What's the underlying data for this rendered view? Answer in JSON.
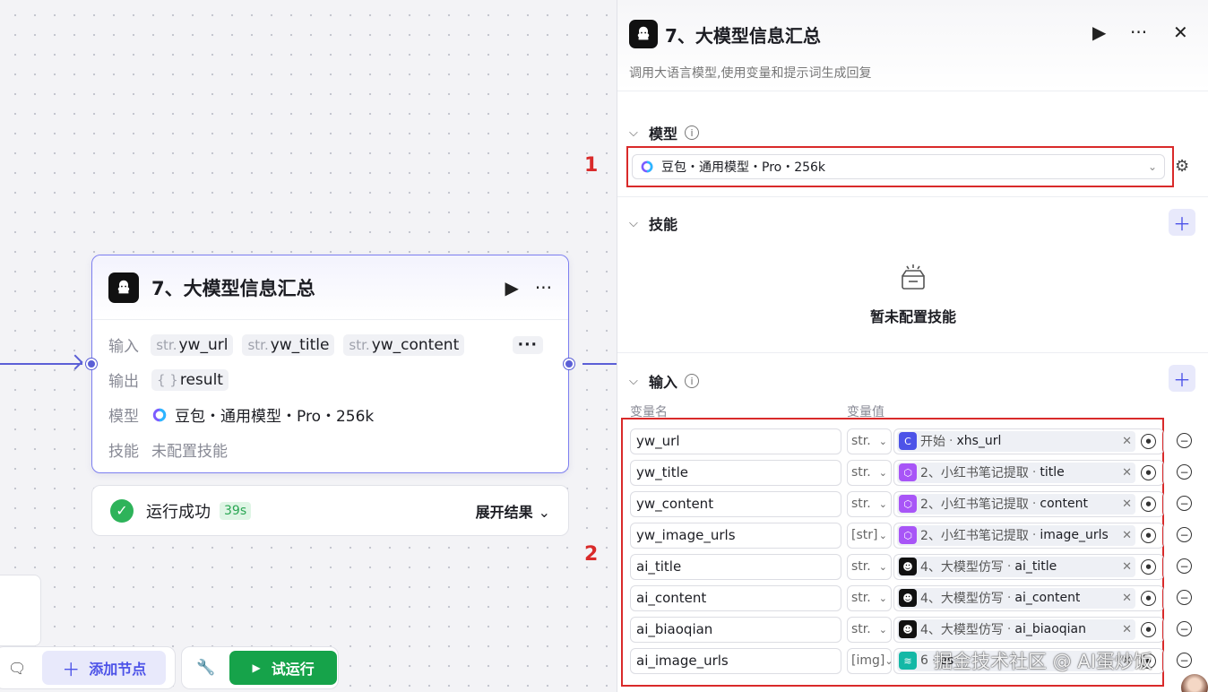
{
  "canvas": {
    "node": {
      "title": "7、大模型信息汇总",
      "input_label": "输入",
      "inputs": [
        {
          "type": "str.",
          "name": "yw_url"
        },
        {
          "type": "str.",
          "name": "yw_title"
        },
        {
          "type": "str.",
          "name": "yw_content"
        }
      ],
      "inputs_more": "···",
      "output_label": "输出",
      "output": {
        "type": "{ }",
        "name": "result"
      },
      "model_label": "模型",
      "model_value": "豆包・通用模型・Pro・256k",
      "skill_label": "技能",
      "skill_value": "未配置技能"
    },
    "run": {
      "status": "运行成功",
      "time": "39s",
      "expand": "展开结果"
    },
    "toolbar": {
      "add_node": "添加节点",
      "try_run": "试运行"
    },
    "annotations": [
      "1",
      "2"
    ]
  },
  "panel": {
    "title": "7、大模型信息汇总",
    "description": "调用大语言模型,使用变量和提示词生成回复",
    "model_section": "模型",
    "model_value": "豆包・通用模型・Pro・256k",
    "skill_section": "技能",
    "skill_empty": "暂未配置技能",
    "input_section": "输入",
    "col_name": "变量名",
    "col_value": "变量值",
    "rows": [
      {
        "name": "yw_url",
        "type": "str.",
        "icon": "start",
        "source": "开始",
        "var": "xhs_url"
      },
      {
        "name": "yw_title",
        "type": "str.",
        "icon": "code",
        "source": "2、小红书笔记提取",
        "var": "title"
      },
      {
        "name": "yw_content",
        "type": "str.",
        "icon": "code",
        "source": "2、小红书笔记提取",
        "var": "content"
      },
      {
        "name": "yw_image_urls",
        "type": "[str]",
        "icon": "code",
        "source": "2、小红书笔记提取",
        "var": "image_urls"
      },
      {
        "name": "ai_title",
        "type": "str.",
        "icon": "llm",
        "source": "4、大模型仿写",
        "var": "ai_title"
      },
      {
        "name": "ai_content",
        "type": "str.",
        "icon": "llm",
        "source": "4、大模型仿写",
        "var": "ai_content"
      },
      {
        "name": "ai_biaoqian",
        "type": "str.",
        "icon": "llm",
        "source": "4、大模型仿写",
        "var": "ai_biaoqian"
      },
      {
        "name": "ai_image_urls",
        "type": "[img]",
        "icon": "layers",
        "source": "6",
        "var": "es"
      }
    ]
  },
  "watermark": "掘金技术社区 @ AI蛋炒饭"
}
